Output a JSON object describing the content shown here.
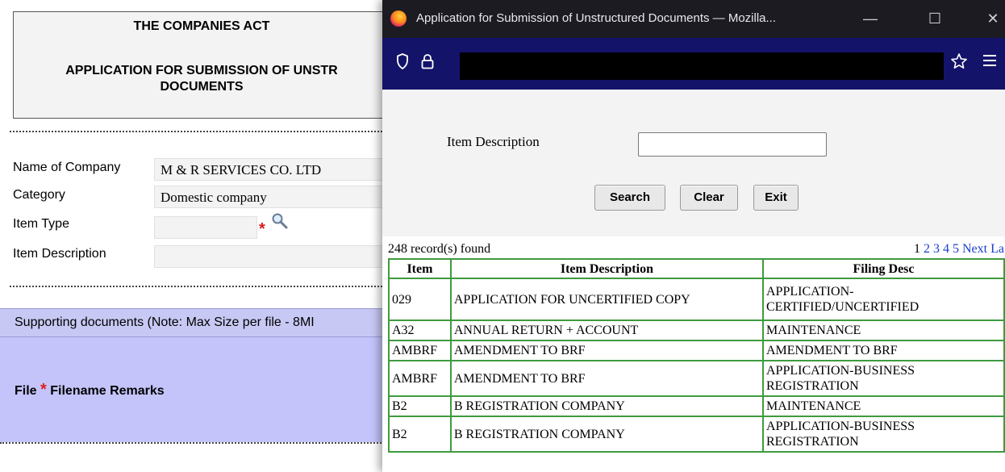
{
  "form": {
    "title_line1": "THE COMPANIES ACT",
    "title_line2a": "APPLICATION FOR SUBMISSION OF UNSTR",
    "title_line2b": "DOCUMENTS",
    "company_label": "Name of Company",
    "company_value": "M & R SERVICES CO. LTD",
    "category_label": "Category",
    "category_value": "Domestic company",
    "item_type_label": "Item Type",
    "item_type_value": "",
    "item_desc_label": "Item Description",
    "item_desc_value": "",
    "required_marker": "*",
    "supporting_header": "Supporting documents (Note: Max Size per file - 8MI",
    "col_file": "File",
    "col_filename": "Filename",
    "col_remarks": "Remarks"
  },
  "popup": {
    "window_title": "Application for Submission of Unstructured Documents — Mozilla...",
    "window_controls": {
      "minimize": "—",
      "maximize": "☐",
      "close": "✕"
    },
    "icons": [
      "firefox-logo",
      "shield-icon",
      "lock-icon",
      "bookmark-star-icon",
      "menu-icon"
    ],
    "search_label": "Item Description",
    "search_value": "",
    "buttons": {
      "search": "Search",
      "clear": "Clear",
      "exit": "Exit"
    },
    "records_found": "248 record(s) found",
    "pager": {
      "current": "1",
      "pages": [
        "2",
        "3",
        "4",
        "5"
      ],
      "next": "Next",
      "last": "La"
    },
    "columns": [
      "Item",
      "Item Description",
      "Filing Desc"
    ],
    "rows": [
      [
        "029",
        "APPLICATION FOR UNCERTIFIED COPY",
        "APPLICATION-CERTIFIED/UNCERTIFIED"
      ],
      [
        "A32",
        "ANNUAL RETURN + ACCOUNT",
        "MAINTENANCE"
      ],
      [
        "AMBRF",
        "AMENDMENT TO BRF",
        "AMENDMENT TO BRF"
      ],
      [
        "AMBRF",
        "AMENDMENT TO BRF",
        "APPLICATION-BUSINESS REGISTRATION"
      ],
      [
        "B2",
        "B REGISTRATION COMPANY",
        "MAINTENANCE"
      ],
      [
        "B2",
        "B REGISTRATION COMPANY",
        "APPLICATION-BUSINESS REGISTRATION"
      ]
    ]
  },
  "colors": {
    "titlebar": "#1c1b22",
    "navbar": "#14136a",
    "table_border": "#3f9a3f",
    "link": "#1a3ec8",
    "supporting_bg": "#c4c4fb",
    "required": "#d91a1a"
  }
}
